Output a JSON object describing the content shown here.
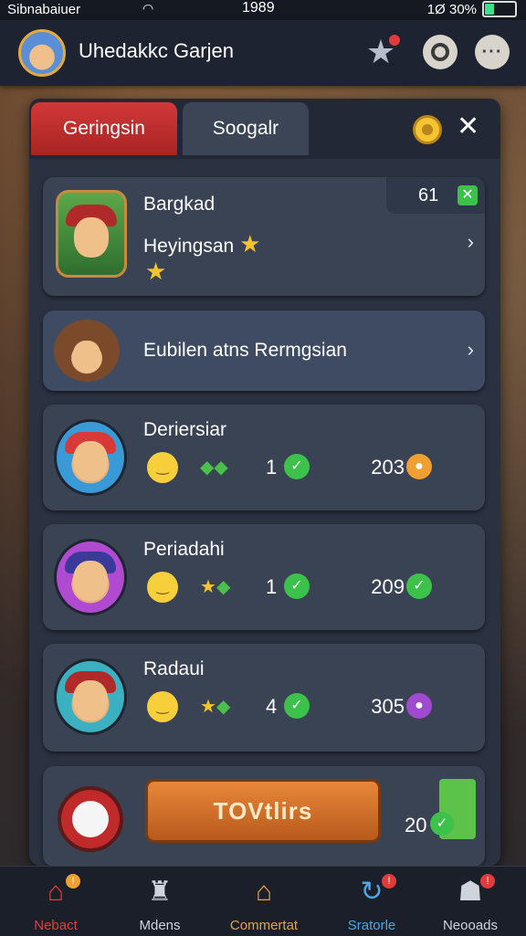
{
  "status_bar": {
    "carrier": "Sibnabaiuer",
    "time": "1989",
    "battery": "1Ø 30%"
  },
  "header": {
    "title": "Uhedakkc Garjen"
  },
  "tabs": [
    {
      "label": "Geringsin"
    },
    {
      "label": "Soogalr"
    }
  ],
  "cards": [
    {
      "name": "Bargkad",
      "subtitle": "Heyingsan",
      "badge": "61",
      "check": "✕"
    },
    {
      "title": "Eubilen atns Rermgsian"
    },
    {
      "name": "Deriersiar",
      "count": "1",
      "score": "203",
      "score_color": "#f0a030"
    },
    {
      "name": "Periadahi",
      "count": "1",
      "score": "209",
      "score_color": "#3cc24a"
    },
    {
      "name": "Radaui",
      "count": "4",
      "score": "305",
      "score_color": "#a04ad0"
    }
  ],
  "action": {
    "button_label": "TOVtlirs",
    "value": "20"
  },
  "bottom_nav": [
    {
      "label": "Nebact",
      "color": "#e0403a",
      "dot": "!"
    },
    {
      "label": "Mdens",
      "color": "#cfd4dc",
      "dot": ""
    },
    {
      "label": "Commertat",
      "color": "#e8a04a",
      "dot": ""
    },
    {
      "label": "Sratorle",
      "color": "#4aa8e8",
      "dot": "!"
    },
    {
      "label": "Neooads",
      "color": "#cfd4dc",
      "dot": "!"
    }
  ]
}
